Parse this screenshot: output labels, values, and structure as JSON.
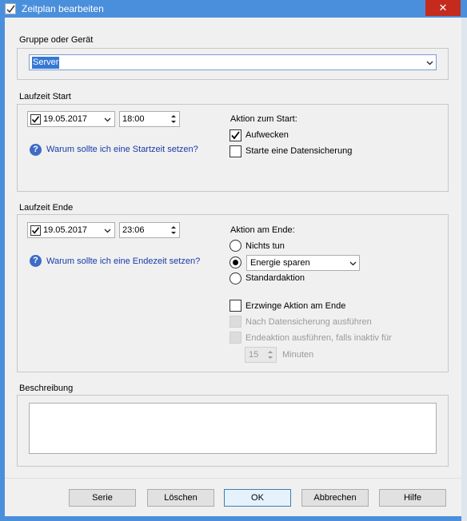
{
  "window": {
    "title": "Zeitplan bearbeiten",
    "close_glyph": "✕"
  },
  "gruppe": {
    "label": "Gruppe oder Gerät",
    "selected": "Server"
  },
  "start": {
    "section_label": "Laufzeit Start",
    "date": "19.05.2017",
    "date_checked": true,
    "time": "18:00",
    "help_link": "Warum sollte ich eine Startzeit setzen?",
    "action_title": "Aktion zum Start:",
    "options": [
      {
        "label": "Aufwecken",
        "checked": true
      },
      {
        "label": "Starte eine Datensicherung",
        "checked": false
      }
    ]
  },
  "end": {
    "section_label": "Laufzeit Ende",
    "date": "19.05.2017",
    "date_checked": true,
    "time": "23:06",
    "help_link": "Warum sollte ich eine Endezeit setzen?",
    "action_title": "Aktion am Ende:",
    "radios": [
      {
        "label": "Nichts tun",
        "selected": false
      },
      {
        "label": "",
        "selected": true
      },
      {
        "label": "Standardaktion",
        "selected": false
      }
    ],
    "energy_select": "Energie sparen",
    "force_label": "Erzwinge Aktion am Ende",
    "after_backup_label": "Nach Datensicherung ausführen",
    "inactive_label": "Endeaktion ausführen, falls inaktiv für",
    "minutes_value": "15",
    "minutes_label": "Minuten"
  },
  "beschreibung": {
    "label": "Beschreibung",
    "value": ""
  },
  "buttons": {
    "serie": "Serie",
    "loeschen": "Löschen",
    "ok": "OK",
    "abbrechen": "Abbrechen",
    "hilfe": "Hilfe"
  },
  "icons": {
    "help": "?",
    "window": "checkmark-app-icon"
  },
  "colors": {
    "titlebar": "#4a8fdc",
    "close": "#c42b1c",
    "link": "#1a3aa8",
    "selection": "#3478d4"
  }
}
